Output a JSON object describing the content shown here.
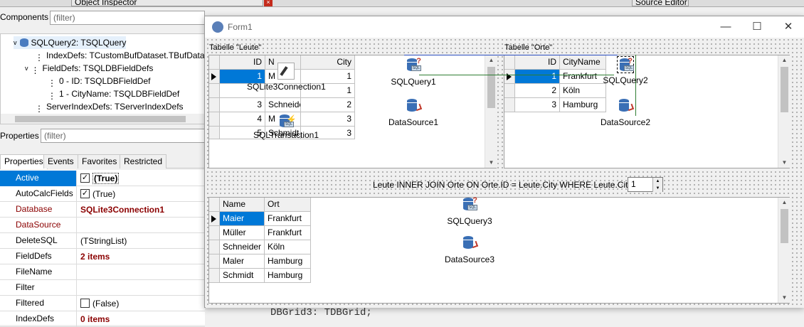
{
  "ide": {
    "object_inspector_title": "Object Inspector",
    "source_editor_title": "Source Editor",
    "close_glyph": "×"
  },
  "components": {
    "label": "Components",
    "filter_placeholder": "(filter)",
    "tree": [
      {
        "label": "SQLQuery2: TSQLQuery",
        "icon": "sql-query-icon"
      },
      {
        "label": "IndexDefs: TCustomBufDataset.TBufDataset",
        "icon": "index-defs-icon"
      },
      {
        "label": "FieldDefs: TSQLDBFieldDefs",
        "icon": "field-defs-icon"
      },
      {
        "label": "0 - ID: TSQLDBFieldDef",
        "icon": "field-def-icon"
      },
      {
        "label": "1 - CityName: TSQLDBFieldDef",
        "icon": "field-def-icon"
      },
      {
        "label": "ServerIndexDefs: TServerIndexDefs",
        "icon": "index-defs-icon"
      }
    ]
  },
  "properties": {
    "label": "Properties",
    "filter_placeholder": "(filter)",
    "tabs": [
      "Properties",
      "Events",
      "Favorites",
      "Restricted"
    ],
    "rows": [
      {
        "name": "Active",
        "value": "(True)",
        "checkbox": true,
        "checked": true,
        "bold_value": true
      },
      {
        "name": "AutoCalcFields",
        "value": "(True)",
        "checkbox": true,
        "checked": true
      },
      {
        "name": "Database",
        "value": "SQLite3Connection1",
        "red": true,
        "bold_value": true
      },
      {
        "name": "DataSource",
        "value": "",
        "red": true
      },
      {
        "name": "DeleteSQL",
        "value": "(TStringList)"
      },
      {
        "name": "FieldDefs",
        "value": "2 items",
        "bold_value": true
      },
      {
        "name": "FileName",
        "value": ""
      },
      {
        "name": "Filter",
        "value": ""
      },
      {
        "name": "Filtered",
        "value": "(False)",
        "checkbox": true,
        "checked": false
      },
      {
        "name": "IndexDefs",
        "value": "0 items",
        "bold_value": true
      }
    ]
  },
  "code_peek": "DBGrid3: TDBGrid;",
  "form": {
    "title": "Form1",
    "label_leute": "Tabelle \"Leute\"",
    "label_orte": "Tabelle \"Orte\"",
    "grid_leute": {
      "headers": [
        "ID",
        "N",
        "City"
      ],
      "rows": [
        [
          "1",
          "M",
          "1"
        ],
        [
          "",
          "",
          "1"
        ],
        [
          "3",
          "Schneider",
          "2"
        ],
        [
          "4",
          "M",
          "3"
        ],
        [
          "5",
          "Schmidt",
          "3"
        ]
      ]
    },
    "grid_orte": {
      "headers": [
        "ID",
        "CityName"
      ],
      "rows": [
        [
          "1",
          "Frankfurt"
        ],
        [
          "2",
          "Köln"
        ],
        [
          "3",
          "Hamburg"
        ]
      ]
    },
    "components": [
      {
        "name": "SQLite3Connection1"
      },
      {
        "name": "SQLTransaction1"
      },
      {
        "name": "SQLQuery1"
      },
      {
        "name": "DataSource1"
      },
      {
        "name": "SQLQuery2"
      },
      {
        "name": "DataSource2"
      },
      {
        "name": "SQLQuery3"
      },
      {
        "name": "DataSource3"
      }
    ],
    "join_label": "Leute INNER JOIN Orte ON Orte.ID = Leute.City WHERE Leute.City =",
    "spin_value": "1",
    "grid_result": {
      "headers": [
        "Name",
        "Ort"
      ],
      "rows": [
        [
          "Maier",
          "Frankfurt"
        ],
        [
          "Müller",
          "Frankfurt"
        ],
        [
          "Schneider",
          "Köln"
        ],
        [
          "Maler",
          "Hamburg"
        ],
        [
          "Schmidt",
          "Hamburg"
        ]
      ]
    }
  },
  "colors": {
    "selection": "#0078d7",
    "property_red": "#8b0000"
  }
}
